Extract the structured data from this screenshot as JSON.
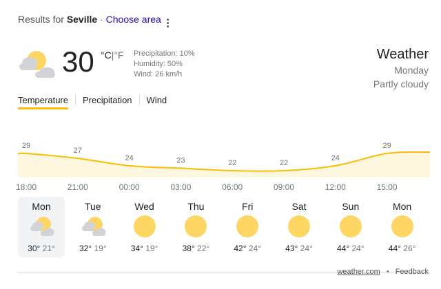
{
  "results": {
    "prefix": "Results for",
    "location": "Seville",
    "separator": "·",
    "choose_area": "Choose area"
  },
  "current": {
    "temperature": "30",
    "unit_c": "°C",
    "unit_sep": "|",
    "unit_f": "°F",
    "precipitation": "Precipitation: 10%",
    "humidity": "Humidity: 50%",
    "wind": "Wind: 26 km/h",
    "icon": "partly-cloudy-icon"
  },
  "header": {
    "title": "Weather",
    "day": "Monday",
    "condition": "Partly cloudy"
  },
  "tabs": [
    {
      "label": "Temperature"
    },
    {
      "label": "Precipitation"
    },
    {
      "label": "Wind"
    }
  ],
  "chart_data": {
    "type": "area",
    "x": [
      "18:00",
      "21:00",
      "00:00",
      "03:00",
      "06:00",
      "09:00",
      "12:00",
      "15:00"
    ],
    "values": [
      29,
      27,
      24,
      23,
      22,
      22,
      24,
      29
    ],
    "data_labels": [
      "29",
      "27",
      "24",
      "23",
      "22",
      "22",
      "24",
      "29"
    ],
    "series": [
      {
        "values": [
          29,
          27,
          24,
          23,
          22,
          22,
          24,
          29
        ]
      }
    ],
    "colors": {
      "line": "#fbbc04",
      "fill": "#fef7e0"
    }
  },
  "forecast": [
    {
      "day": "Mon",
      "high": "30°",
      "low": "21°",
      "icon": "partly-cloudy-icon"
    },
    {
      "day": "Tue",
      "high": "32°",
      "low": "19°",
      "icon": "partly-cloudy-icon"
    },
    {
      "day": "Wed",
      "high": "34°",
      "low": "19°",
      "icon": "sun-icon"
    },
    {
      "day": "Thu",
      "high": "38°",
      "low": "22°",
      "icon": "sun-icon"
    },
    {
      "day": "Fri",
      "high": "42°",
      "low": "24°",
      "icon": "sun-icon"
    },
    {
      "day": "Sat",
      "high": "43°",
      "low": "24°",
      "icon": "sun-icon"
    },
    {
      "day": "Sun",
      "high": "44°",
      "low": "24°",
      "icon": "sun-icon"
    },
    {
      "day": "Mon",
      "high": "44°",
      "low": "26°",
      "icon": "sun-icon"
    }
  ],
  "footer": {
    "source": "weather.com",
    "separator": "•",
    "feedback": "Feedback"
  },
  "colors": {
    "sun": "#fdd663",
    "cloud": "#d2d3d7",
    "link": "#1a0dab",
    "accent": "#fbbc04"
  }
}
